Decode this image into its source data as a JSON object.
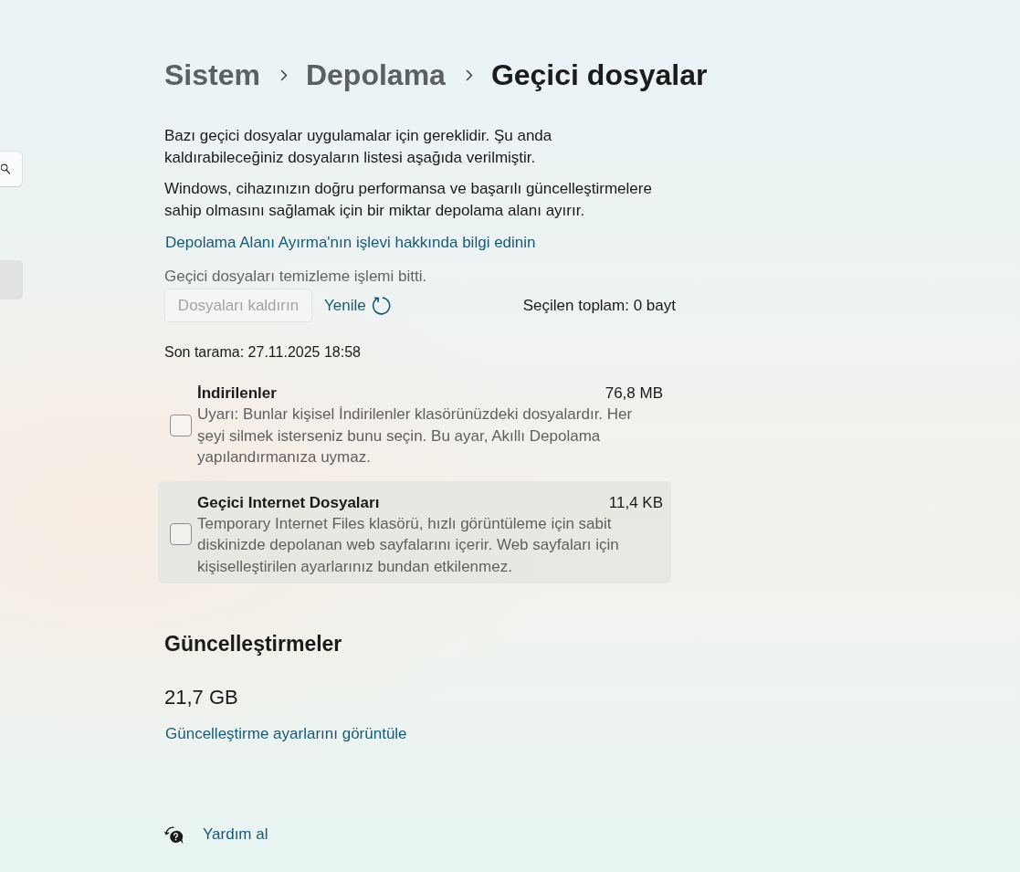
{
  "sidebar": {
    "search_field": true,
    "items": [
      {
        "selected": true
      }
    ]
  },
  "breadcrumb": [
    {
      "label": "Sistem",
      "current": false
    },
    {
      "label": "Depolama",
      "current": false
    },
    {
      "label": "Geçici dosyalar",
      "current": true
    }
  ],
  "intro": [
    "Bazı geçici dosyalar uygulamalar için gereklidir. Şu anda kaldırabileceğiniz dosyaların listesi aşağıda verilmiştir.",
    "Windows, cihazınızın doğru performansa ve başarılı güncelleştirmelere sahip olmasını sağlamak için bir miktar depolama alanı ayırır."
  ],
  "learn_more_link": "Depolama Alanı Ayırma'nın işlevi hakkında bilgi edinin",
  "status": "Geçici dosyaları temizleme işlemi bitti.",
  "actions": {
    "remove_button": {
      "label": "Dosyaları kaldırın",
      "disabled": true
    },
    "refresh_link": "Yenile",
    "selected_total": "Seçilen toplam: 0 bayt"
  },
  "last_scan": "Son tarama: 27.11.2025 18:58",
  "items": [
    {
      "title": "İndirilenler",
      "size": "76,8 MB",
      "description": "Uyarı: Bunlar kişisel İndirilenler klasörünüzdeki dosyalardır. Her şeyi silmek isterseniz bunu seçin. Bu ayar, Akıllı Depolama yapılandırmanıza uymaz.",
      "checked": false,
      "highlighted": false
    },
    {
      "title": "Geçici Internet Dosyaları",
      "size": "11,4 KB",
      "description": "Temporary Internet Files klasörü, hızlı görüntüleme için sabit diskinizde depolanan web sayfalarını içerir. Web sayfaları için kişiselleştirilen ayarlarınız bundan etkilenmez.",
      "checked": false,
      "highlighted": true
    }
  ],
  "updates": {
    "heading": "Güncelleştirmeler",
    "size": "21,7 GB",
    "link": "Güncelleştirme ayarlarını görüntüle"
  },
  "help_link": "Yardım al"
}
